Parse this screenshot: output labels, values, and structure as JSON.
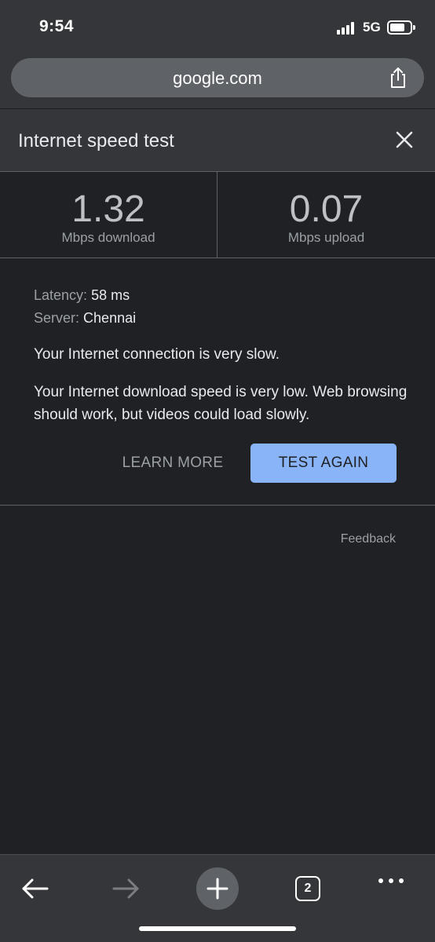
{
  "status_bar": {
    "time": "9:54",
    "network": "5G"
  },
  "url_bar": {
    "url": "google.com"
  },
  "card": {
    "title": "Internet speed test",
    "download": {
      "value": "1.32",
      "label": "Mbps download"
    },
    "upload": {
      "value": "0.07",
      "label": "Mbps upload"
    },
    "latency_label": "Latency:",
    "latency_value": "58 ms",
    "server_label": "Server:",
    "server_value": "Chennai",
    "summary": "Your Internet connection is very slow.",
    "detail": "Your Internet download speed is very low. Web browsing should work, but videos could load slowly.",
    "learn_more_label": "LEARN MORE",
    "test_again_label": "TEST AGAIN",
    "feedback_label": "Feedback"
  },
  "toolbar": {
    "tab_count": "2"
  },
  "colors": {
    "background": "#202124",
    "chrome": "#35363a",
    "accent": "#8ab4f8"
  }
}
